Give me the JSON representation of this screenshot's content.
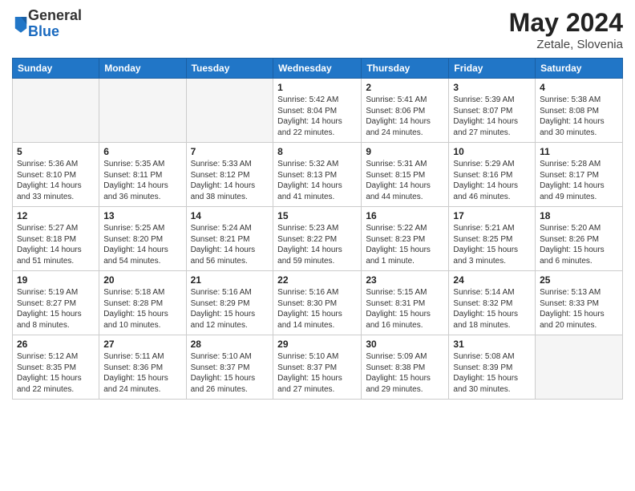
{
  "header": {
    "logo_general": "General",
    "logo_blue": "Blue",
    "month_year": "May 2024",
    "location": "Zetale, Slovenia"
  },
  "days_of_week": [
    "Sunday",
    "Monday",
    "Tuesday",
    "Wednesday",
    "Thursday",
    "Friday",
    "Saturday"
  ],
  "weeks": [
    [
      {
        "num": "",
        "info": ""
      },
      {
        "num": "",
        "info": ""
      },
      {
        "num": "",
        "info": ""
      },
      {
        "num": "1",
        "info": "Sunrise: 5:42 AM\nSunset: 8:04 PM\nDaylight: 14 hours\nand 22 minutes."
      },
      {
        "num": "2",
        "info": "Sunrise: 5:41 AM\nSunset: 8:06 PM\nDaylight: 14 hours\nand 24 minutes."
      },
      {
        "num": "3",
        "info": "Sunrise: 5:39 AM\nSunset: 8:07 PM\nDaylight: 14 hours\nand 27 minutes."
      },
      {
        "num": "4",
        "info": "Sunrise: 5:38 AM\nSunset: 8:08 PM\nDaylight: 14 hours\nand 30 minutes."
      }
    ],
    [
      {
        "num": "5",
        "info": "Sunrise: 5:36 AM\nSunset: 8:10 PM\nDaylight: 14 hours\nand 33 minutes."
      },
      {
        "num": "6",
        "info": "Sunrise: 5:35 AM\nSunset: 8:11 PM\nDaylight: 14 hours\nand 36 minutes."
      },
      {
        "num": "7",
        "info": "Sunrise: 5:33 AM\nSunset: 8:12 PM\nDaylight: 14 hours\nand 38 minutes."
      },
      {
        "num": "8",
        "info": "Sunrise: 5:32 AM\nSunset: 8:13 PM\nDaylight: 14 hours\nand 41 minutes."
      },
      {
        "num": "9",
        "info": "Sunrise: 5:31 AM\nSunset: 8:15 PM\nDaylight: 14 hours\nand 44 minutes."
      },
      {
        "num": "10",
        "info": "Sunrise: 5:29 AM\nSunset: 8:16 PM\nDaylight: 14 hours\nand 46 minutes."
      },
      {
        "num": "11",
        "info": "Sunrise: 5:28 AM\nSunset: 8:17 PM\nDaylight: 14 hours\nand 49 minutes."
      }
    ],
    [
      {
        "num": "12",
        "info": "Sunrise: 5:27 AM\nSunset: 8:18 PM\nDaylight: 14 hours\nand 51 minutes."
      },
      {
        "num": "13",
        "info": "Sunrise: 5:25 AM\nSunset: 8:20 PM\nDaylight: 14 hours\nand 54 minutes."
      },
      {
        "num": "14",
        "info": "Sunrise: 5:24 AM\nSunset: 8:21 PM\nDaylight: 14 hours\nand 56 minutes."
      },
      {
        "num": "15",
        "info": "Sunrise: 5:23 AM\nSunset: 8:22 PM\nDaylight: 14 hours\nand 59 minutes."
      },
      {
        "num": "16",
        "info": "Sunrise: 5:22 AM\nSunset: 8:23 PM\nDaylight: 15 hours\nand 1 minute."
      },
      {
        "num": "17",
        "info": "Sunrise: 5:21 AM\nSunset: 8:25 PM\nDaylight: 15 hours\nand 3 minutes."
      },
      {
        "num": "18",
        "info": "Sunrise: 5:20 AM\nSunset: 8:26 PM\nDaylight: 15 hours\nand 6 minutes."
      }
    ],
    [
      {
        "num": "19",
        "info": "Sunrise: 5:19 AM\nSunset: 8:27 PM\nDaylight: 15 hours\nand 8 minutes."
      },
      {
        "num": "20",
        "info": "Sunrise: 5:18 AM\nSunset: 8:28 PM\nDaylight: 15 hours\nand 10 minutes."
      },
      {
        "num": "21",
        "info": "Sunrise: 5:16 AM\nSunset: 8:29 PM\nDaylight: 15 hours\nand 12 minutes."
      },
      {
        "num": "22",
        "info": "Sunrise: 5:16 AM\nSunset: 8:30 PM\nDaylight: 15 hours\nand 14 minutes."
      },
      {
        "num": "23",
        "info": "Sunrise: 5:15 AM\nSunset: 8:31 PM\nDaylight: 15 hours\nand 16 minutes."
      },
      {
        "num": "24",
        "info": "Sunrise: 5:14 AM\nSunset: 8:32 PM\nDaylight: 15 hours\nand 18 minutes."
      },
      {
        "num": "25",
        "info": "Sunrise: 5:13 AM\nSunset: 8:33 PM\nDaylight: 15 hours\nand 20 minutes."
      }
    ],
    [
      {
        "num": "26",
        "info": "Sunrise: 5:12 AM\nSunset: 8:35 PM\nDaylight: 15 hours\nand 22 minutes."
      },
      {
        "num": "27",
        "info": "Sunrise: 5:11 AM\nSunset: 8:36 PM\nDaylight: 15 hours\nand 24 minutes."
      },
      {
        "num": "28",
        "info": "Sunrise: 5:10 AM\nSunset: 8:37 PM\nDaylight: 15 hours\nand 26 minutes."
      },
      {
        "num": "29",
        "info": "Sunrise: 5:10 AM\nSunset: 8:37 PM\nDaylight: 15 hours\nand 27 minutes."
      },
      {
        "num": "30",
        "info": "Sunrise: 5:09 AM\nSunset: 8:38 PM\nDaylight: 15 hours\nand 29 minutes."
      },
      {
        "num": "31",
        "info": "Sunrise: 5:08 AM\nSunset: 8:39 PM\nDaylight: 15 hours\nand 30 minutes."
      },
      {
        "num": "",
        "info": ""
      }
    ]
  ]
}
